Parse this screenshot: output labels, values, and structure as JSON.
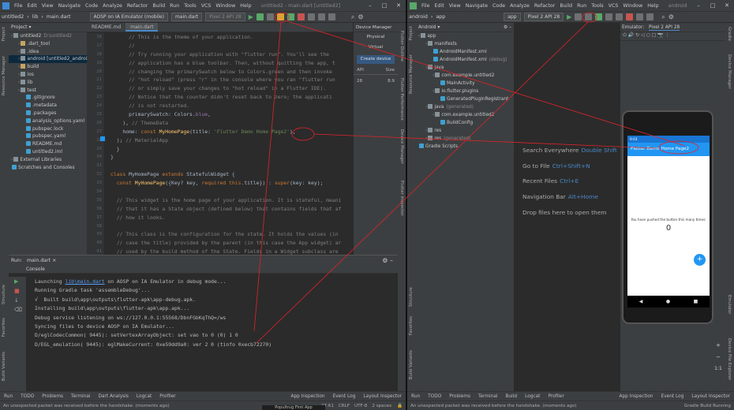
{
  "left": {
    "menu": [
      "File",
      "Edit",
      "View",
      "Navigate",
      "Code",
      "Analyze",
      "Refactor",
      "Build",
      "Run",
      "Tools",
      "VCS",
      "Window",
      "Help"
    ],
    "title": "untitled2 - main.dart [untitled2]",
    "breadcrumb": [
      "untitled2",
      "lib",
      "main.dart"
    ],
    "device_dropdown": "AOSP on IA Emulator (mobile)",
    "config_dropdown": "main.dart",
    "avd_dropdown": "Pixel 2 API 28",
    "left_strip": [
      "Project",
      "Resource Manager"
    ],
    "project_header": "Project",
    "tree": [
      {
        "label": "untitled2",
        "extra": "D:\\untitled2",
        "indent": 0,
        "kind": "folder"
      },
      {
        "label": ".dart_tool",
        "indent": 1,
        "kind": "folder-y"
      },
      {
        "label": ".idea",
        "indent": 1,
        "kind": "folder"
      },
      {
        "label": "android [untitled2_android]",
        "indent": 1,
        "kind": "folder",
        "selected": true
      },
      {
        "label": "build",
        "indent": 1,
        "kind": "folder-y"
      },
      {
        "label": "ios",
        "indent": 1,
        "kind": "folder"
      },
      {
        "label": "lib",
        "indent": 1,
        "kind": "folder"
      },
      {
        "label": "test",
        "indent": 1,
        "kind": "folder"
      },
      {
        "label": ".gitignore",
        "indent": 2,
        "kind": "file"
      },
      {
        "label": ".metadata",
        "indent": 2,
        "kind": "file"
      },
      {
        "label": ".packages",
        "indent": 2,
        "kind": "file"
      },
      {
        "label": "analysis_options.yaml",
        "indent": 2,
        "kind": "file"
      },
      {
        "label": "pubspec.lock",
        "indent": 2,
        "kind": "file"
      },
      {
        "label": "pubspec.yaml",
        "indent": 2,
        "kind": "file"
      },
      {
        "label": "README.md",
        "indent": 2,
        "kind": "file"
      },
      {
        "label": "untitled2.iml",
        "indent": 2,
        "kind": "file"
      },
      {
        "label": "External Libraries",
        "indent": 0,
        "kind": "folder"
      },
      {
        "label": "Scratches and Consoles",
        "indent": 0,
        "kind": "file"
      }
    ],
    "editor_tabs": [
      "README.md",
      "main.dart"
    ],
    "line_numbers": [
      "16",
      "17",
      "18",
      "19",
      "20",
      "21",
      "22",
      "23",
      "24",
      "25",
      "26",
      "27",
      "28",
      "29",
      "30",
      "31",
      "32",
      "33",
      "34",
      "35",
      "36",
      "37",
      "38",
      "39",
      "40",
      "41"
    ],
    "code": [
      [
        [
          "cm",
          "      // This is the theme of your application."
        ]
      ],
      [
        [
          "cm",
          "      //"
        ]
      ],
      [
        [
          "cm",
          "      // Try running your application with \"flutter run\". You'll see the"
        ]
      ],
      [
        [
          "cm",
          "      // application has a blue toolbar. Then, without quitting the app, t"
        ]
      ],
      [
        [
          "cm",
          "      // changing the primarySwatch below to Colors.green and then invoke"
        ]
      ],
      [
        [
          "cm",
          "      // \"hot reload\" (press \"r\" in the console where you ran \"flutter run"
        ]
      ],
      [
        [
          "cm",
          "      // or simply save your changes to \"hot reload\" in a Flutter IDE)."
        ]
      ],
      [
        [
          "cm",
          "      // Notice that the counter didn't reset back to zero; the applicati"
        ]
      ],
      [
        [
          "cm",
          "      // is not restarted."
        ]
      ],
      [
        [
          "",
          "      primarySwatch: Colors."
        ],
        [
          "nm",
          "blue"
        ],
        [
          "",
          ","
        ]
      ],
      [
        [
          "",
          "    ), "
        ],
        [
          "cm",
          "// ThemeData"
        ]
      ],
      [
        [
          "",
          "    home: "
        ],
        [
          "kw",
          "const "
        ],
        [
          "fn",
          "MyHomePage"
        ],
        [
          "",
          "(title: "
        ],
        [
          "st",
          "'Flutter Demo Home Page2'"
        ],
        [
          "",
          "),"
        ]
      ],
      [
        [
          "",
          "  ); "
        ],
        [
          "cm",
          "// MaterialApp"
        ]
      ],
      [
        [
          "",
          "  }"
        ]
      ],
      [
        [
          "",
          "}"
        ]
      ],
      [
        [
          "",
          ""
        ]
      ],
      [
        [
          "kw",
          "class "
        ],
        [
          "",
          "MyHomePage "
        ],
        [
          "kw",
          "extends "
        ],
        [
          "",
          "StatefulWidget {"
        ]
      ],
      [
        [
          "",
          "  "
        ],
        [
          "kw",
          "const "
        ],
        [
          "fn",
          "MyHomePage"
        ],
        [
          "",
          "({Key? key, "
        ],
        [
          "kw",
          "required this"
        ],
        [
          "",
          ".title}) : "
        ],
        [
          "kw",
          "super"
        ],
        [
          "",
          "(key: key);"
        ]
      ],
      [
        [
          "",
          ""
        ]
      ],
      [
        [
          "cm",
          "  // This widget is the home page of your application. It is stateful, meani"
        ]
      ],
      [
        [
          "cm",
          "  // that it has a State object (defined below) that contains fields that af"
        ]
      ],
      [
        [
          "cm",
          "  // how it looks."
        ]
      ],
      [
        [
          "",
          ""
        ]
      ],
      [
        [
          "cm",
          "  // This class is the configuration for the state. It holds the values (in"
        ]
      ],
      [
        [
          "cm",
          "  // case the title) provided by the parent (in this case the App widget) ar"
        ]
      ],
      [
        [
          "cm",
          "  // used by the build method of the State. Fields in a Widget subclass are"
        ]
      ]
    ],
    "device_manager": {
      "title": "Device Manager",
      "tabs": [
        "Physical",
        "Virtual"
      ],
      "create": "Create device",
      "cols": [
        "API",
        "Size"
      ],
      "row": [
        "28",
        "8.9"
      ]
    },
    "right_strip": [
      "Flutter Outline",
      "Flutter Performance",
      "Device Manager",
      "Flutter Inspector"
    ],
    "run": {
      "title": "Run:",
      "config": "main.dart",
      "console_tab": "Console"
    },
    "console": [
      [
        [
          "",
          "Launching "
        ],
        [
          "lnk",
          "lib\\main.dart"
        ],
        [
          "",
          " on AOSP on IA Emulator in debug mode..."
        ]
      ],
      [
        [
          "",
          "Running Gradle task 'assembleDebug'..."
        ]
      ],
      [
        [
          "",
          "√  Built build\\app\\outputs\\flutter-apk\\app-debug.apk."
        ]
      ],
      [
        [
          "",
          "Installing build\\app\\outputs\\flutter-apk\\app.apk..."
        ]
      ],
      [
        [
          "",
          "Debug service listening on ws://127.0.0.1:55568/DbnFGbKqThQ=/ws"
        ]
      ],
      [
        [
          "",
          "Syncing files to device AOSP on IA Emulator..."
        ]
      ],
      [
        [
          "",
          "D/eglCodecCommon( 9445): setVertexArrayObject: set vao to 0 (0) 1 0"
        ]
      ],
      [
        [
          "",
          "D/EGL_emulation( 9445): eglMakeCurrent: 0xe59dd9a0: ver 2 0 (tinfo 0xecb72270)"
        ]
      ]
    ],
    "bottom_tabs": [
      "Run",
      "TODO",
      "Problems",
      "Terminal",
      "Dart Analysis",
      "Logcat",
      "Profiler",
      "App Inspection",
      "Event Log",
      "Layout Inspector"
    ],
    "status": {
      "message": "An unexpected packet was received before the handshake. (moments ago)",
      "pos": "27:61",
      "crlf": "CRLF",
      "enc": "UTF-8",
      "indent": "2 spaces"
    }
  },
  "right": {
    "menu": [
      "File",
      "Edit",
      "View",
      "Navigate",
      "Code",
      "Analyze",
      "Refactor",
      "Build",
      "Run",
      "Tools",
      "VCS",
      "Window",
      "Help"
    ],
    "title": "android",
    "breadcrumb": [
      "android",
      "app"
    ],
    "config_dropdown": "app",
    "avd_dropdown": "Pixel 2 API 28",
    "left_strip": [
      "Project",
      "Resource Manager",
      "Structure",
      "Favorites",
      "Build Variants"
    ],
    "project_dropdown": "Android",
    "tree": [
      {
        "label": "app",
        "indent": 0,
        "kind": "folder"
      },
      {
        "label": "manifests",
        "indent": 1,
        "kind": "folder",
        "selected": true
      },
      {
        "label": "AndroidManifest.xml",
        "indent": 2,
        "kind": "file"
      },
      {
        "label": "AndroidManifest.xml",
        "extra": "(debug)",
        "indent": 2,
        "kind": "file"
      },
      {
        "label": "java",
        "indent": 1,
        "kind": "folder"
      },
      {
        "label": "com.example.untitled2",
        "indent": 2,
        "kind": "folder"
      },
      {
        "label": "MainActivity",
        "indent": 3,
        "kind": "file"
      },
      {
        "label": "io.flutter.plugins",
        "indent": 2,
        "kind": "folder"
      },
      {
        "label": "GeneratedPluginRegistrant",
        "indent": 3,
        "kind": "file"
      },
      {
        "label": "java",
        "extra": "(generated)",
        "indent": 1,
        "kind": "folder"
      },
      {
        "label": "com.example.untitled2",
        "indent": 2,
        "kind": "folder"
      },
      {
        "label": "BuildConfig",
        "indent": 3,
        "kind": "file"
      },
      {
        "label": "res",
        "indent": 1,
        "kind": "folder"
      },
      {
        "label": "res",
        "extra": "(generated)",
        "indent": 1,
        "kind": "folder"
      },
      {
        "label": "Gradle Scripts",
        "indent": 0,
        "kind": "file"
      }
    ],
    "welcome": [
      {
        "label": "Search Everywhere",
        "shortcut": "Double Shift"
      },
      {
        "label": "Go to File",
        "shortcut": "Ctrl+Shift+N"
      },
      {
        "label": "Recent Files",
        "shortcut": "Ctrl+E"
      },
      {
        "label": "Navigation Bar",
        "shortcut": "Alt+Home"
      },
      {
        "label": "Drop files here to open them",
        "shortcut": ""
      }
    ],
    "emulator": {
      "label": "Emulator:",
      "device": "Pixel 2 API 28",
      "time": "9:03",
      "app_title": "Flutter Demo Home Page2",
      "message": "You have pushed the button this many times:",
      "counter": "0",
      "fab": "+"
    },
    "right_strip": [
      "Gradle",
      "Device Manager",
      "Emulator",
      "Device File Explorer"
    ],
    "bottom_tabs": [
      "Run",
      "TODO",
      "Problems",
      "Terminal",
      "Build",
      "Logcat",
      "Profiler",
      "App Inspection",
      "Event Log",
      "Layout Inspector"
    ],
    "status": {
      "message": "An unexpected packet was received before the handshake. (moments ago)",
      "right": "Gradle Build Running"
    }
  },
  "taskbar_text": "Popultrug First App",
  "colors": {
    "annotation": "#e0242a",
    "accent": "#4a88c7",
    "run_green": "#59a869",
    "flutter_blue": "#2196f3"
  }
}
